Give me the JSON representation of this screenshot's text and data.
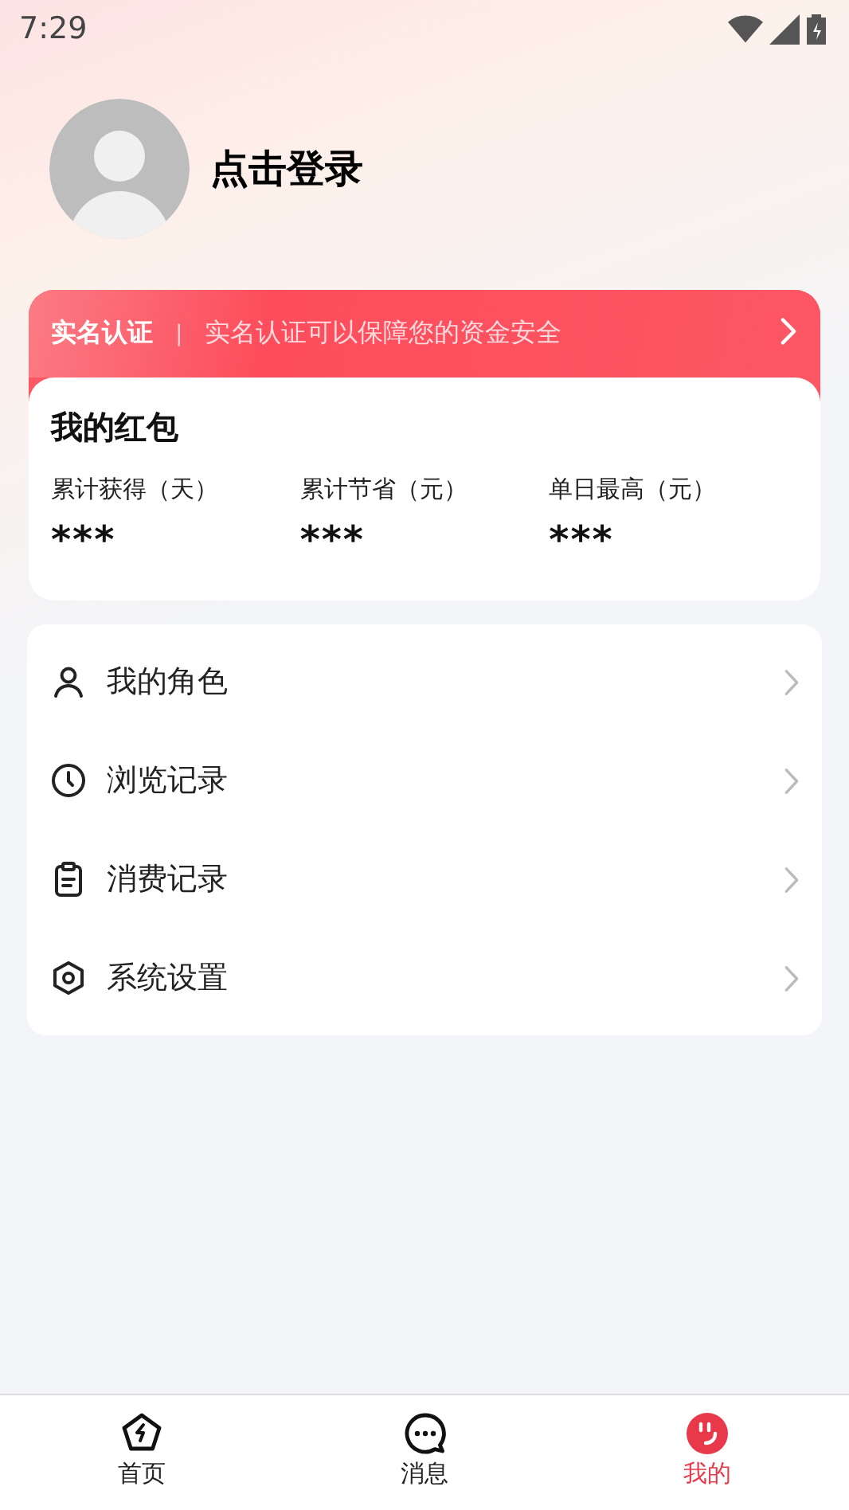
{
  "status_bar": {
    "time": "7:29"
  },
  "profile": {
    "login_label": "点击登录"
  },
  "verify_banner": {
    "title": "实名认证",
    "separator": "|",
    "message": "实名认证可以保障您的资金安全"
  },
  "red_packet": {
    "title": "我的红包",
    "stats": [
      {
        "label": "累计获得（天）",
        "value": "***"
      },
      {
        "label": "累计节省（元）",
        "value": "***"
      },
      {
        "label": "单日最高（元）",
        "value": "***"
      }
    ]
  },
  "menu": [
    {
      "kind": "person",
      "label": "我的角色"
    },
    {
      "kind": "clock",
      "label": "浏览记录"
    },
    {
      "kind": "clipboard",
      "label": "消费记录"
    },
    {
      "kind": "settings",
      "label": "系统设置"
    }
  ],
  "tab_bar": [
    {
      "kind": "home",
      "label": "首页",
      "selected": false
    },
    {
      "kind": "messages",
      "label": "消息",
      "selected": false
    },
    {
      "kind": "me",
      "label": "我的",
      "selected": true
    }
  ]
}
